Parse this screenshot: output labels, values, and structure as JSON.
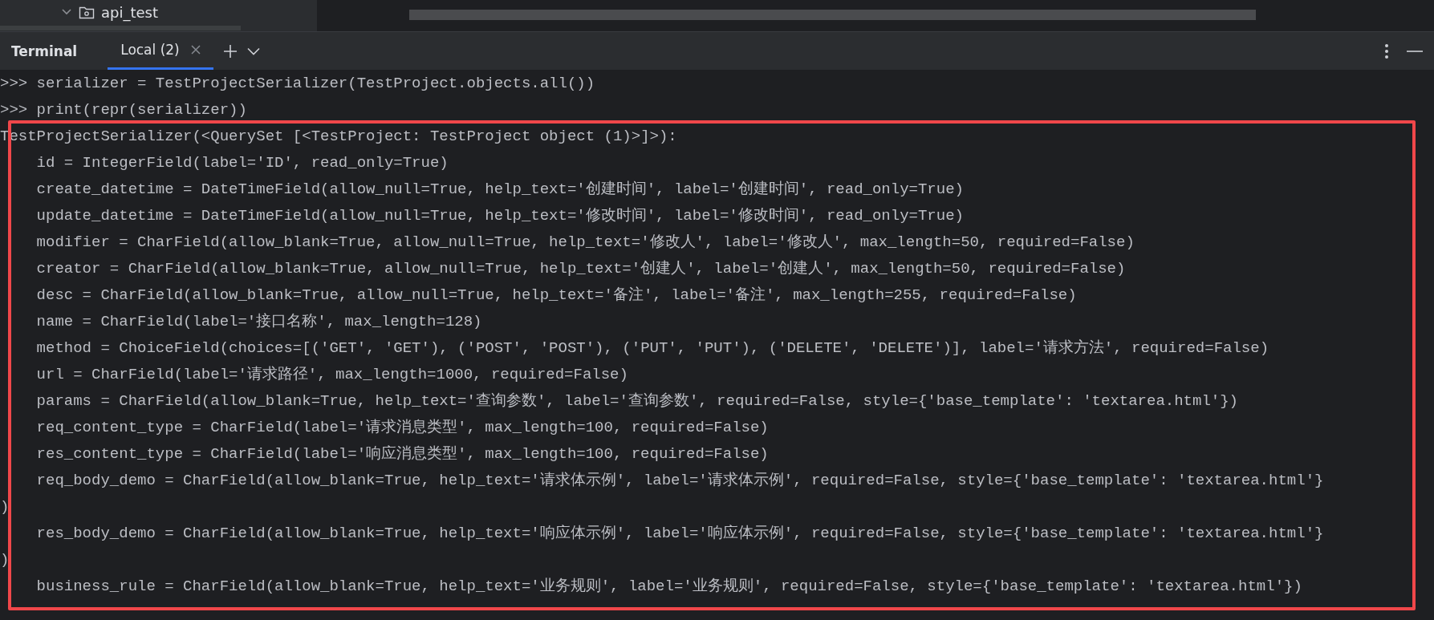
{
  "project_tree": {
    "item": {
      "label": "api_test",
      "expanded": true
    }
  },
  "terminal": {
    "title": "Terminal",
    "tabs": [
      {
        "label": "Local (2)",
        "selected": true
      }
    ],
    "lines": [
      ">>> serializer = TestProjectSerializer(TestProject.objects.all())",
      ">>> print(repr(serializer))"
    ],
    "highlighted_output": [
      "TestProjectSerializer(<QuerySet [<TestProject: TestProject object (1)>]>):",
      "    id = IntegerField(label='ID', read_only=True)",
      "    create_datetime = DateTimeField(allow_null=True, help_text='创建时间', label='创建时间', read_only=True)",
      "    update_datetime = DateTimeField(allow_null=True, help_text='修改时间', label='修改时间', read_only=True)",
      "    modifier = CharField(allow_blank=True, allow_null=True, help_text='修改人', label='修改人', max_length=50, required=False)",
      "    creator = CharField(allow_blank=True, allow_null=True, help_text='创建人', label='创建人', max_length=50, required=False)",
      "    desc = CharField(allow_blank=True, allow_null=True, help_text='备注', label='备注', max_length=255, required=False)",
      "    name = CharField(label='接口名称', max_length=128)",
      "    method = ChoiceField(choices=[('GET', 'GET'), ('POST', 'POST'), ('PUT', 'PUT'), ('DELETE', 'DELETE')], label='请求方法', required=False)",
      "    url = CharField(label='请求路径', max_length=1000, required=False)",
      "    params = CharField(allow_blank=True, help_text='查询参数', label='查询参数', required=False, style={'base_template': 'textarea.html'})",
      "    req_content_type = CharField(label='请求消息类型', max_length=100, required=False)",
      "    res_content_type = CharField(label='响应消息类型', max_length=100, required=False)",
      "    req_body_demo = CharField(allow_blank=True, help_text='请求体示例', label='请求体示例', required=False, style={'base_template': 'textarea.html'}",
      ")",
      "    res_body_demo = CharField(allow_blank=True, help_text='响应体示例', label='响应体示例', required=False, style={'base_template': 'textarea.html'}",
      ")",
      "    business_rule = CharField(allow_blank=True, help_text='业务规则', label='业务规则', required=False, style={'base_template': 'textarea.html'})"
    ]
  }
}
